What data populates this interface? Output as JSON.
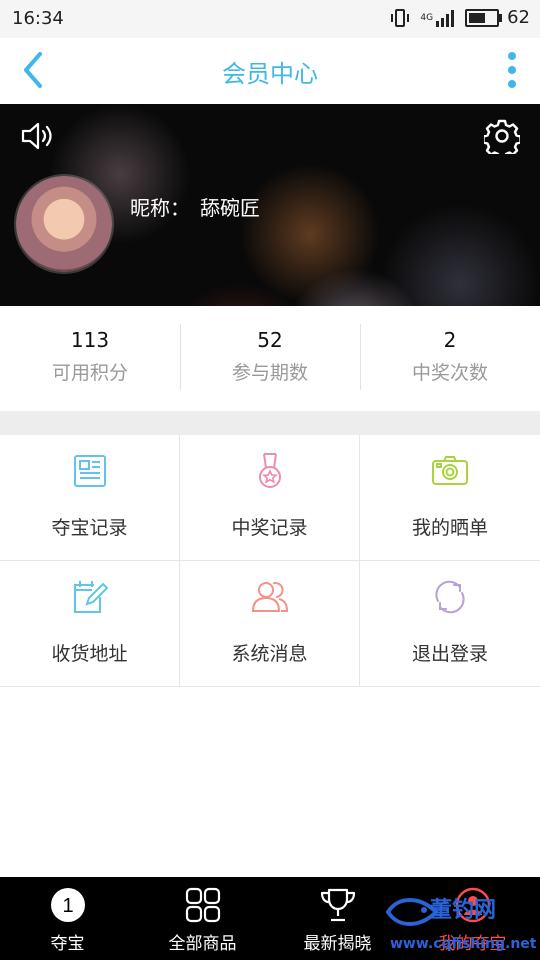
{
  "status_bar": {
    "time": "16:34",
    "network": "4G",
    "battery": "62",
    "battery_level": 0.62
  },
  "nav": {
    "title": "会员中心"
  },
  "profile": {
    "nickname_label": "昵称：",
    "nickname": "舔碗匠"
  },
  "stats": [
    {
      "value": "113",
      "label": "可用积分"
    },
    {
      "value": "52",
      "label": "参与期数"
    },
    {
      "value": "2",
      "label": "中奖次数"
    }
  ],
  "menu": [
    {
      "label": "夺宝记录",
      "icon": "record-icon",
      "color": "#62c2ee"
    },
    {
      "label": "中奖记录",
      "icon": "medal-icon",
      "color": "#f08bb0"
    },
    {
      "label": "我的晒单",
      "icon": "camera-icon",
      "color": "#a8d33b"
    },
    {
      "label": "收货地址",
      "icon": "edit-address-icon",
      "color": "#5fc6e8"
    },
    {
      "label": "系统消息",
      "icon": "users-icon",
      "color": "#f5918a"
    },
    {
      "label": "退出登录",
      "icon": "refresh-icon",
      "color": "#b5a0d8"
    }
  ],
  "tabs": [
    {
      "label": "夺宝",
      "icon": "number-one-icon",
      "badge": "1"
    },
    {
      "label": "全部商品",
      "icon": "grid-icon"
    },
    {
      "label": "最新揭晓",
      "icon": "trophy-icon"
    },
    {
      "label": "我的夺宝",
      "icon": "user-icon"
    }
  ],
  "watermark": {
    "name": "董钓网",
    "url": "www.cqfishing.net"
  }
}
